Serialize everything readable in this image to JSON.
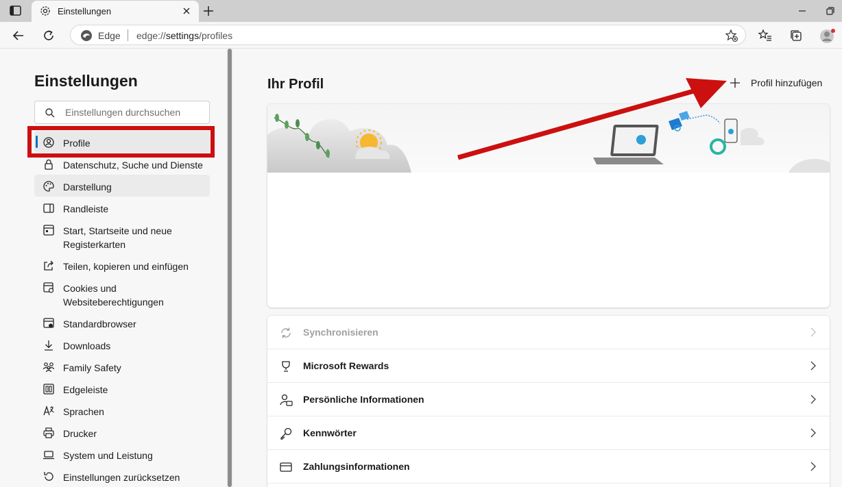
{
  "browser": {
    "tab": {
      "title": "Einstellungen"
    },
    "address": {
      "site_label": "Edge",
      "url_prefix": "edge://",
      "url_bold": "settings",
      "url_suffix": "/profiles"
    }
  },
  "sidebar": {
    "title": "Einstellungen",
    "search_placeholder": "Einstellungen durchsuchen",
    "items": [
      {
        "label": "Profile",
        "icon": "profile-icon",
        "state": "selected"
      },
      {
        "label": "Datenschutz, Suche und Dienste",
        "icon": "lock-icon"
      },
      {
        "label": "Darstellung",
        "icon": "palette-icon",
        "state": "hover"
      },
      {
        "label": "Randleiste",
        "icon": "sidebar-icon"
      },
      {
        "label": "Start, Startseite und neue Registerkarten",
        "icon": "home-tabs-icon"
      },
      {
        "label": "Teilen, kopieren und einfügen",
        "icon": "share-icon"
      },
      {
        "label": "Cookies und Websiteberechtigungen",
        "icon": "cookies-icon"
      },
      {
        "label": "Standardbrowser",
        "icon": "default-browser-icon"
      },
      {
        "label": "Downloads",
        "icon": "download-icon"
      },
      {
        "label": "Family Safety",
        "icon": "family-icon"
      },
      {
        "label": "Edgeleiste",
        "icon": "edge-bar-icon"
      },
      {
        "label": "Sprachen",
        "icon": "language-icon"
      },
      {
        "label": "Drucker",
        "icon": "printer-icon"
      },
      {
        "label": "System und Leistung",
        "icon": "laptop-icon"
      },
      {
        "label": "Einstellungen zurücksetzen",
        "icon": "reset-icon"
      }
    ]
  },
  "main": {
    "title": "Ihr Profil",
    "add_profile_label": "Profil hinzufügen",
    "rows": [
      {
        "label": "Synchronisieren",
        "icon": "sync-icon",
        "disabled": true
      },
      {
        "label": "Microsoft Rewards",
        "icon": "rewards-icon"
      },
      {
        "label": "Persönliche Informationen",
        "icon": "personal-info-icon"
      },
      {
        "label": "Kennwörter",
        "icon": "key-icon"
      },
      {
        "label": "Zahlungsinformationen",
        "icon": "card-icon"
      }
    ]
  },
  "annotations": {
    "color": "#cc0f0f"
  },
  "colors": {
    "accent": "#0f6cbd"
  }
}
